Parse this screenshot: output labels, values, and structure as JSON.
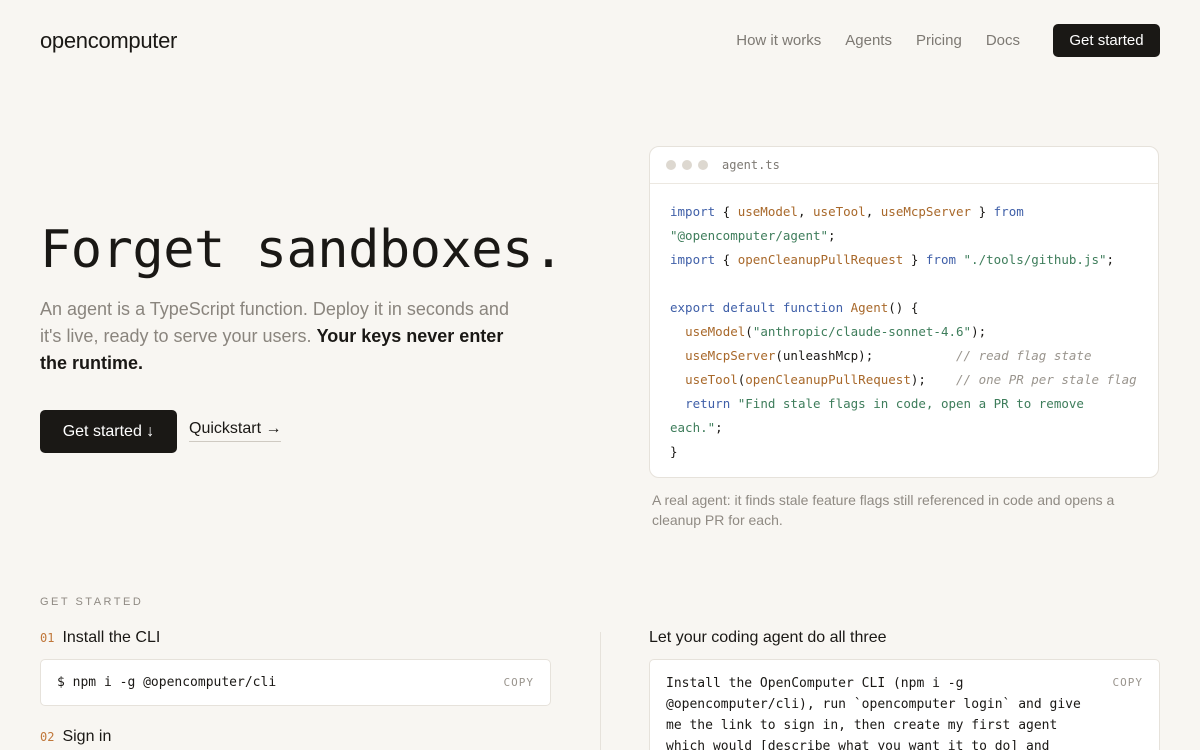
{
  "nav": {
    "logo": "opencomputer",
    "links": [
      "How it works",
      "Agents",
      "Pricing",
      "Docs"
    ],
    "cta": "Get started"
  },
  "hero": {
    "title": "Forget sandboxes.",
    "subtitle": "An agent is a TypeScript function. Deploy it in seconds and it's live, ready to serve your users.",
    "subtitle_strong": "Your keys never enter the runtime.",
    "primary_button": "Get started ↓",
    "secondary_link": "Quickstart →"
  },
  "code_card": {
    "filename": "agent.ts",
    "caption": "A real agent: it finds stale feature flags still referenced in code and opens a cleanup PR for each.",
    "code": {
      "import1_kw": "import",
      "import1_open": " { ",
      "import1_a": "useModel",
      "import1_b": "useTool",
      "import1_c": "useMcpServer",
      "import1_close": " } ",
      "from_kw": "from",
      "import1_src": "\"@opencomputer/agent\"",
      "import2_kw": "import",
      "import2_fn": "openCleanupPullRequest",
      "import2_src": "\"./tools/github.js\"",
      "export_kw": "export default function",
      "agent_fn": "Agent",
      "use_model": "useModel",
      "model_str": "\"anthropic/claude-sonnet-4.6\"",
      "use_mcp": "useMcpServer",
      "mcp_arg": "unleashMcp",
      "mcp_comment": "// read flag state",
      "use_tool": "useTool",
      "tool_arg": "openCleanupPullRequest",
      "tool_comment": "// one PR per stale flag",
      "return_kw": "return",
      "return_str1": "\"Find stale flags in code, open a PR to remove",
      "return_str2": "each.\""
    }
  },
  "get_started": {
    "label": "GET STARTED",
    "steps": [
      {
        "num": "01",
        "title": "Install the CLI",
        "command": "$ npm i -g @opencomputer/cli",
        "copy": "COPY"
      },
      {
        "num": "02",
        "title": "Sign in"
      }
    ],
    "coding_agent": {
      "title": "Let your coding agent do all three",
      "prompt": "Install the OpenComputer CLI (npm i -g @opencomputer/cli), run `opencomputer login` and give me the link to sign in, then create my first agent which would [describe what you want it to do] and",
      "copy": "COPY"
    }
  },
  "colors": {
    "background": "#f8f6f2",
    "ink": "#1a1815",
    "muted": "#8a857e",
    "accent": "#c0773a",
    "keyword": "#3f5fa8",
    "function": "#a8682a",
    "string": "#3e7d5b"
  },
  "icons": [
    "window-dot-icon"
  ]
}
